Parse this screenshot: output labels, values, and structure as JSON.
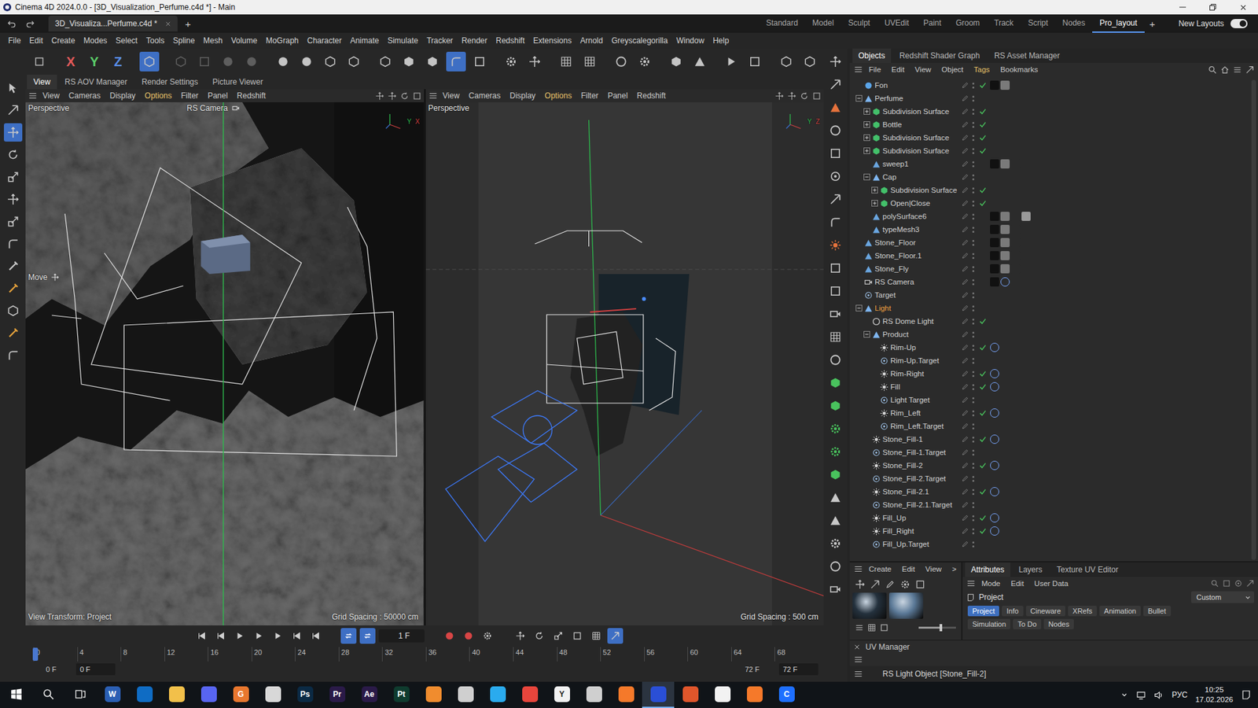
{
  "window": {
    "title": "Cinema 4D 2024.0.0 - [3D_Visualization_Perfume.c4d *] - Main"
  },
  "documentTab": {
    "label": "3D_Visualiza...Perfume.c4d *",
    "selected": true
  },
  "addDocument": "+",
  "layouts": [
    {
      "label": "Standard",
      "selected": false
    },
    {
      "label": "Model",
      "selected": false
    },
    {
      "label": "Sculpt",
      "selected": false
    },
    {
      "label": "UVEdit",
      "selected": false
    },
    {
      "label": "Paint",
      "selected": false
    },
    {
      "label": "Groom",
      "selected": false
    },
    {
      "label": "Track",
      "selected": false
    },
    {
      "label": "Script",
      "selected": false
    },
    {
      "label": "Nodes",
      "selected": false
    },
    {
      "label": "Pro_layout",
      "selected": true
    }
  ],
  "addLayout": "+",
  "newLayouts": {
    "label": "New Layouts",
    "on": true
  },
  "menu": [
    "File",
    "Edit",
    "Create",
    "Modes",
    "Select",
    "Tools",
    "Spline",
    "Mesh",
    "Volume",
    "MoGraph",
    "Character",
    "Animate",
    "Simulate",
    "Tracker",
    "Render",
    "Redshift",
    "Extensions",
    "Arnold",
    "Greyscalegorilla",
    "Window",
    "Help"
  ],
  "toolbar": {
    "leading": [
      false
    ],
    "axes": [
      {
        "label": "X",
        "on": true
      },
      {
        "label": "Y",
        "on": true
      },
      {
        "label": "Z",
        "on": true
      }
    ],
    "groups": [
      {
        "disabled": false,
        "buttons": [
          true
        ]
      },
      {
        "disabled": true,
        "buttons": [
          false,
          false,
          false,
          false
        ]
      },
      {
        "disabled": false,
        "buttons": [
          false,
          false,
          false,
          false
        ]
      },
      {
        "disabled": false,
        "buttons": [
          false,
          false,
          false,
          true,
          false
        ]
      },
      {
        "disabled": false,
        "buttons": [
          false,
          false
        ]
      },
      {
        "disabled": false,
        "buttons": [
          false,
          false
        ]
      },
      {
        "disabled": false,
        "buttons": [
          false,
          false
        ]
      },
      {
        "disabled": false,
        "buttons": [
          false,
          false
        ]
      },
      {
        "disabled": false,
        "buttons": [
          false,
          false
        ]
      },
      {
        "disabled": false,
        "buttons": [
          false,
          false
        ]
      }
    ]
  },
  "leftTools": [
    false,
    false,
    true,
    false,
    false,
    false,
    false,
    false,
    false,
    false,
    false,
    false,
    false
  ],
  "viewportTabs": [
    {
      "label": "View",
      "selected": true
    },
    {
      "label": "RS AOV Manager",
      "selected": false
    },
    {
      "label": "Render Settings",
      "selected": false
    },
    {
      "label": "Picture Viewer",
      "selected": false
    }
  ],
  "viewports": [
    {
      "menu": [
        {
          "label": "View",
          "active": false
        },
        {
          "label": "Cameras",
          "active": false
        },
        {
          "label": "Display",
          "active": false
        },
        {
          "label": "Options",
          "active": true
        },
        {
          "label": "Filter",
          "active": false
        },
        {
          "label": "Panel",
          "active": false
        },
        {
          "label": "Redshift",
          "active": false
        }
      ],
      "label": "Perspective",
      "camera": "RS Camera",
      "cursor": "Move",
      "transform": "View Transform: Project",
      "grid": "Grid Spacing : 50000 cm",
      "gizmo": [
        "Y",
        "X"
      ]
    },
    {
      "menu": [
        {
          "label": "View",
          "active": false
        },
        {
          "label": "Cameras",
          "active": false
        },
        {
          "label": "Display",
          "active": false
        },
        {
          "label": "Options",
          "active": true
        },
        {
          "label": "Filter",
          "active": false
        },
        {
          "label": "Panel",
          "active": false
        },
        {
          "label": "Redshift",
          "active": false
        }
      ],
      "label": "Perspective",
      "grid": "Grid Spacing : 500 cm",
      "gizmo": [
        "Y",
        "Z"
      ]
    }
  ],
  "timeline": {
    "frame": "1 F",
    "loop": [
      true,
      true
    ],
    "record": [
      true,
      true
    ],
    "tools": [
      false,
      false,
      false,
      false,
      false,
      true
    ],
    "ticks": [
      "0",
      "4",
      "8",
      "12",
      "16",
      "20",
      "24",
      "28",
      "32",
      "36",
      "40",
      "44",
      "48",
      "52",
      "56",
      "60",
      "64",
      "68"
    ],
    "playhead": 0,
    "start": "0 F",
    "startField": "0 F",
    "end": "72 F",
    "endField": "72 F"
  },
  "objectManager": {
    "tabs": [
      {
        "label": "Objects",
        "selected": true
      },
      {
        "label": "Redshift Shader Graph",
        "selected": false
      },
      {
        "label": "RS Asset Manager",
        "selected": false
      }
    ],
    "menu": [
      {
        "label": "File",
        "active": false
      },
      {
        "label": "Edit",
        "active": false
      },
      {
        "label": "View",
        "active": false
      },
      {
        "label": "Object",
        "active": false
      },
      {
        "label": "Tags",
        "active": true
      },
      {
        "label": "Bookmarks",
        "active": false
      }
    ],
    "rows": [
      {
        "name": "Fon",
        "depth": 0,
        "hasChildren": false,
        "expanded": false,
        "kind": "sky",
        "enabled": true,
        "tags": 2,
        "selected": false
      },
      {
        "name": "Perfume",
        "depth": 0,
        "hasChildren": true,
        "expanded": true,
        "kind": "null",
        "enabled": false,
        "tags": 0,
        "selected": false
      },
      {
        "name": "Subdivision Surface",
        "depth": 1,
        "hasChildren": true,
        "expanded": false,
        "kind": "generator",
        "enabled": true,
        "tags": 0,
        "selected": false
      },
      {
        "name": "Bottle",
        "depth": 1,
        "hasChildren": true,
        "expanded": false,
        "kind": "generator",
        "enabled": true,
        "tags": 0,
        "selected": false
      },
      {
        "name": "Subdivision Surface",
        "depth": 1,
        "hasChildren": true,
        "expanded": false,
        "kind": "generator",
        "enabled": true,
        "tags": 0,
        "selected": false
      },
      {
        "name": "Subdivision Surface",
        "depth": 1,
        "hasChildren": true,
        "expanded": false,
        "kind": "generator",
        "enabled": true,
        "tags": 0,
        "selected": false
      },
      {
        "name": "sweep1",
        "depth": 1,
        "hasChildren": false,
        "expanded": false,
        "kind": "poly",
        "enabled": false,
        "tags": 3,
        "selected": false
      },
      {
        "name": "Cap",
        "depth": 1,
        "hasChildren": true,
        "expanded": true,
        "kind": "null",
        "enabled": false,
        "tags": 0,
        "selected": false
      },
      {
        "name": "Subdivision Surface",
        "depth": 2,
        "hasChildren": true,
        "expanded": false,
        "kind": "generator",
        "enabled": true,
        "tags": 0,
        "selected": false
      },
      {
        "name": "Open|Close",
        "depth": 2,
        "hasChildren": true,
        "expanded": false,
        "kind": "generator",
        "enabled": true,
        "tags": 0,
        "selected": false
      },
      {
        "name": "polySurface6",
        "depth": 1,
        "hasChildren": false,
        "expanded": false,
        "kind": "poly",
        "enabled": false,
        "tags": 4,
        "selected": false
      },
      {
        "name": "typeMesh3",
        "depth": 1,
        "hasChildren": false,
        "expanded": false,
        "kind": "poly",
        "enabled": false,
        "tags": 3,
        "selected": false
      },
      {
        "name": "Stone_Floor",
        "depth": 0,
        "hasChildren": false,
        "expanded": false,
        "kind": "poly",
        "enabled": false,
        "tags": 3,
        "selected": false
      },
      {
        "name": "Stone_Floor.1",
        "depth": 0,
        "hasChildren": false,
        "expanded": false,
        "kind": "poly",
        "enabled": false,
        "tags": 3,
        "selected": false
      },
      {
        "name": "Stone_Fly",
        "depth": 0,
        "hasChildren": false,
        "expanded": false,
        "kind": "poly",
        "enabled": false,
        "tags": 3,
        "selected": false
      },
      {
        "name": "RS Camera",
        "depth": 0,
        "hasChildren": false,
        "expanded": false,
        "kind": "camera",
        "enabled": false,
        "tags": 2,
        "selected": false
      },
      {
        "name": "Target",
        "depth": 0,
        "hasChildren": false,
        "expanded": false,
        "kind": "target",
        "enabled": false,
        "tags": 0,
        "selected": false
      },
      {
        "name": "Light",
        "depth": 0,
        "hasChildren": true,
        "expanded": true,
        "kind": "null",
        "enabled": false,
        "tags": 0,
        "selected": true
      },
      {
        "name": "RS Dome Light",
        "depth": 1,
        "hasChildren": false,
        "expanded": false,
        "kind": "dome",
        "enabled": true,
        "tags": 0,
        "selected": false
      },
      {
        "name": "Product",
        "depth": 1,
        "hasChildren": true,
        "expanded": true,
        "kind": "null",
        "enabled": false,
        "tags": 0,
        "selected": false
      },
      {
        "name": "Rim-Up",
        "depth": 2,
        "hasChildren": false,
        "expanded": false,
        "kind": "light",
        "enabled": true,
        "tags": 1,
        "selected": false
      },
      {
        "name": "Rim-Up.Target",
        "depth": 2,
        "hasChildren": false,
        "expanded": false,
        "kind": "target",
        "enabled": false,
        "tags": 0,
        "selected": false
      },
      {
        "name": "Rim-Right",
        "depth": 2,
        "hasChildren": false,
        "expanded": false,
        "kind": "light",
        "enabled": true,
        "tags": 1,
        "selected": false
      },
      {
        "name": "Fill",
        "depth": 2,
        "hasChildren": false,
        "expanded": false,
        "kind": "light",
        "enabled": true,
        "tags": 1,
        "selected": false
      },
      {
        "name": "Light Target",
        "depth": 2,
        "hasChildren": false,
        "expanded": false,
        "kind": "target",
        "enabled": false,
        "tags": 0,
        "selected": false
      },
      {
        "name": "Rim_Left",
        "depth": 2,
        "hasChildren": false,
        "expanded": false,
        "kind": "light",
        "enabled": true,
        "tags": 1,
        "selected": false
      },
      {
        "name": "Rim_Left.Target",
        "depth": 2,
        "hasChildren": false,
        "expanded": false,
        "kind": "target",
        "enabled": false,
        "tags": 0,
        "selected": false
      },
      {
        "name": "Stone_Fill-1",
        "depth": 1,
        "hasChildren": false,
        "expanded": false,
        "kind": "light",
        "enabled": true,
        "tags": 1,
        "selected": false
      },
      {
        "name": "Stone_Fill-1.Target",
        "depth": 1,
        "hasChildren": false,
        "expanded": false,
        "kind": "target",
        "enabled": false,
        "tags": 0,
        "selected": false
      },
      {
        "name": "Stone_Fill-2",
        "depth": 1,
        "hasChildren": false,
        "expanded": false,
        "kind": "light",
        "enabled": true,
        "tags": 1,
        "selected": false
      },
      {
        "name": "Stone_Fill-2.Target",
        "depth": 1,
        "hasChildren": false,
        "expanded": false,
        "kind": "target",
        "enabled": false,
        "tags": 0,
        "selected": false
      },
      {
        "name": "Stone_Fill-2.1",
        "depth": 1,
        "hasChildren": false,
        "expanded": false,
        "kind": "light",
        "enabled": true,
        "tags": 1,
        "selected": false
      },
      {
        "name": "Stone_Fill-2.1.Target",
        "depth": 1,
        "hasChildren": false,
        "expanded": false,
        "kind": "target",
        "enabled": false,
        "tags": 0,
        "selected": false
      },
      {
        "name": "Fill_Up",
        "depth": 1,
        "hasChildren": false,
        "expanded": false,
        "kind": "light",
        "enabled": true,
        "tags": 1,
        "selected": false
      },
      {
        "name": "Fill_Right",
        "depth": 1,
        "hasChildren": false,
        "expanded": false,
        "kind": "light",
        "enabled": true,
        "tags": 1,
        "selected": false
      },
      {
        "name": "Fill_Up.Target",
        "depth": 1,
        "hasChildren": false,
        "expanded": false,
        "kind": "target",
        "enabled": false,
        "tags": 0,
        "selected": false
      }
    ]
  },
  "materials": {
    "menu": [
      "Create",
      "Edit",
      "View",
      ">"
    ],
    "items": [
      {
        "color": "#24313d"
      },
      {
        "color": "#5a7896"
      }
    ],
    "zoom": 0.6
  },
  "attributes": {
    "tabs": [
      {
        "label": "Attributes",
        "selected": true
      },
      {
        "label": "Layers",
        "selected": false
      },
      {
        "label": "Texture UV Editor",
        "selected": false
      }
    ],
    "menu": [
      "Mode",
      "Edit",
      "User Data"
    ],
    "header": "Project",
    "preset": "Custom",
    "sections": [
      {
        "label": "Project",
        "selected": true
      },
      {
        "label": "Info",
        "selected": false
      },
      {
        "label": "Cineware",
        "selected": false
      },
      {
        "label": "XRefs",
        "selected": false
      },
      {
        "label": "Animation",
        "selected": false
      },
      {
        "label": "Bullet",
        "selected": false
      },
      {
        "label": "Simulation",
        "selected": false
      },
      {
        "label": "To Do",
        "selected": false
      },
      {
        "label": "Nodes",
        "selected": false
      }
    ]
  },
  "uvManager": {
    "title": "UV Manager"
  },
  "status": "RS Light Object [Stone_Fill-2]",
  "taskbar": {
    "apps": [
      {
        "label": "",
        "color": "#ffffff",
        "active": false
      },
      {
        "label": "",
        "color": "#e6e6e6",
        "active": false
      },
      {
        "label": "",
        "color": "#e6e6e6",
        "active": false
      },
      {
        "label": "W",
        "color": "#2b5fb4",
        "active": false
      },
      {
        "label": "",
        "color": "#0f6cc4",
        "active": false
      },
      {
        "label": "",
        "color": "#f2c04a",
        "active": false
      },
      {
        "label": "",
        "color": "#5865f2",
        "active": false
      },
      {
        "label": "G",
        "color": "#e8772e",
        "active": false
      },
      {
        "label": "",
        "color": "#d8d8d8",
        "active": false
      },
      {
        "label": "Ps",
        "color": "#0b2a44",
        "active": false
      },
      {
        "label": "Pr",
        "color": "#2a1a48",
        "active": false
      },
      {
        "label": "Ae",
        "color": "#2a1a48",
        "active": false
      },
      {
        "label": "Pt",
        "color": "#0f3b2e",
        "active": false
      },
      {
        "label": "",
        "color": "#f08c2e",
        "active": false
      },
      {
        "label": "",
        "color": "#cfcfcf",
        "active": false
      },
      {
        "label": "",
        "color": "#2aabee",
        "active": false
      },
      {
        "label": "",
        "color": "#e8453c",
        "active": false
      },
      {
        "label": "Y",
        "color": "#f2f2f2",
        "active": false
      },
      {
        "label": "",
        "color": "#cfcfcf",
        "active": false
      },
      {
        "label": "",
        "color": "#f5792a",
        "active": false
      },
      {
        "label": "",
        "color": "#2a4fd6",
        "active": true
      },
      {
        "label": "",
        "color": "#e0562b",
        "active": false
      },
      {
        "label": "",
        "color": "#f2f2f2",
        "active": false
      },
      {
        "label": "",
        "color": "#f5792a",
        "active": false
      },
      {
        "label": "C",
        "color": "#1e6fff",
        "active": false
      }
    ],
    "language": "РУС",
    "time": "10:25",
    "date": "17.02.2026"
  }
}
